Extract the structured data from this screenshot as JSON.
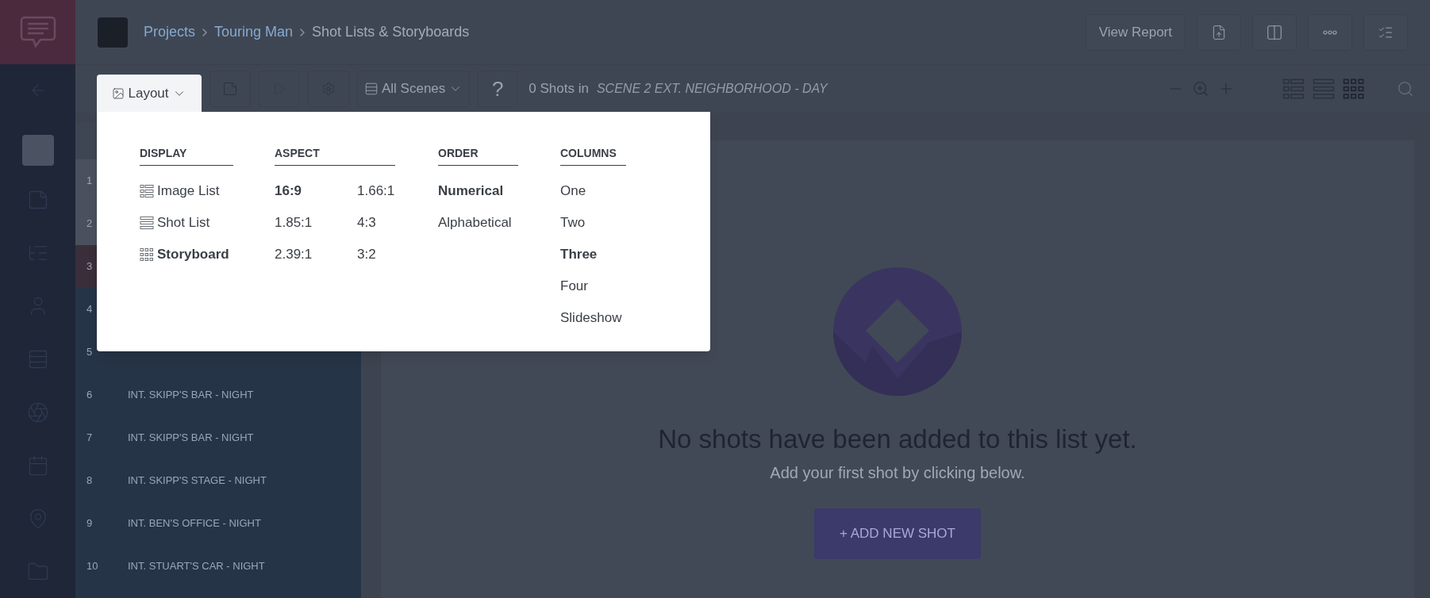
{
  "breadcrumb": {
    "links": [
      "Projects",
      "Touring Man"
    ],
    "current": "Shot Lists & Storyboards"
  },
  "header_buttons": [
    {
      "kind": "text",
      "label": "View Report"
    },
    {
      "kind": "export"
    },
    {
      "kind": "panels"
    },
    {
      "kind": "more"
    },
    {
      "kind": "checklist"
    }
  ],
  "toolbar": {
    "layout_button": "Layout",
    "scene_filter": "All Scenes",
    "help": "?",
    "shot_count": "0 Shots in",
    "scene_name": "SCENE 2 EXT. NEIGHBORHOOD - DAY"
  },
  "view_modes": [
    {
      "kind": "image-list",
      "selected": false
    },
    {
      "kind": "shot-list",
      "selected": false
    },
    {
      "kind": "storyboard",
      "selected": true
    }
  ],
  "layout_menu": {
    "display": {
      "heading": "DISPLAY",
      "items": [
        {
          "kind": "image-list",
          "label": "Image List",
          "selected": false
        },
        {
          "kind": "shot-list",
          "label": "Shot List",
          "selected": false
        },
        {
          "kind": "storyboard",
          "label": "Storyboard",
          "selected": true
        }
      ]
    },
    "aspect": {
      "heading": "ASPECT",
      "items": [
        {
          "label": "16:9",
          "selected": true
        },
        {
          "label": "1.66:1",
          "selected": false
        },
        {
          "label": "1.85:1",
          "selected": false
        },
        {
          "label": "4:3",
          "selected": false
        },
        {
          "label": "2.39:1",
          "selected": false
        },
        {
          "label": "3:2",
          "selected": false
        }
      ]
    },
    "order": {
      "heading": "ORDER",
      "items": [
        {
          "label": "Numerical",
          "selected": true
        },
        {
          "label": "Alphabetical",
          "selected": false
        }
      ]
    },
    "columns": {
      "heading": "COLUMNS",
      "items": [
        {
          "label": "One",
          "selected": false
        },
        {
          "label": "Two",
          "selected": false
        },
        {
          "label": "Three",
          "selected": true
        },
        {
          "label": "Four",
          "selected": false
        },
        {
          "label": "Slideshow",
          "selected": false
        }
      ]
    }
  },
  "scenes": [
    {
      "number": "1",
      "color": "#4a515e"
    },
    {
      "number": "2",
      "color": "#4a515e"
    },
    {
      "number": "3",
      "color": "#3a2e3b"
    },
    {
      "number": "4",
      "color": "#263447"
    },
    {
      "number": "5",
      "color": "#263447"
    },
    {
      "number": "6",
      "title": "INT. SKIPP'S BAR - NIGHT",
      "color": "#263447"
    },
    {
      "number": "7",
      "title": "INT. SKIPP'S BAR - NIGHT",
      "color": "#263447"
    },
    {
      "number": "8",
      "title": "INT. SKIPP'S STAGE - NIGHT",
      "color": "#263447"
    },
    {
      "number": "9",
      "title": "INT. BEN'S OFFICE - NIGHT",
      "color": "#263447"
    },
    {
      "number": "10",
      "title": "INT. STUART'S CAR - NIGHT",
      "color": "#263447"
    }
  ],
  "empty_state": {
    "title": "No shots have been added to this list yet.",
    "subtitle": "Add your first shot by clicking below.",
    "button": "+ ADD NEW SHOT"
  }
}
